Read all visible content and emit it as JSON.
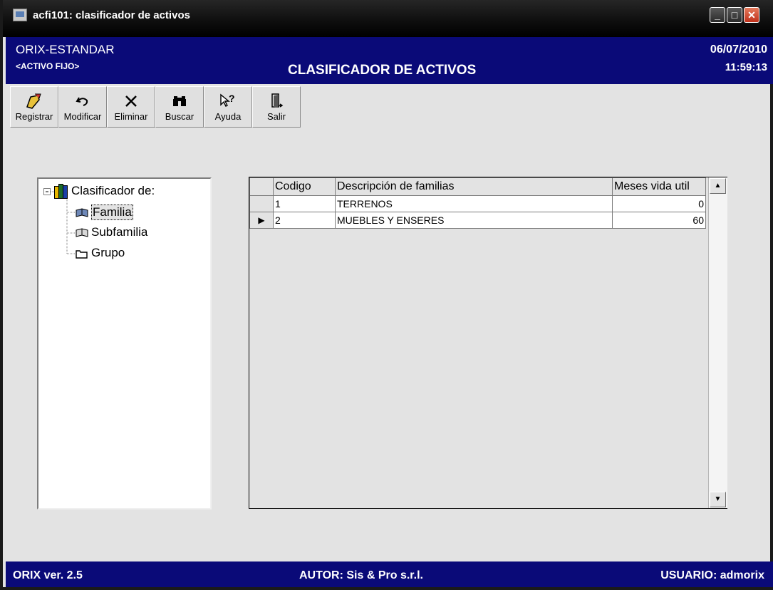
{
  "window": {
    "title": "acfi101: clasificador de activos"
  },
  "header": {
    "company": "ORIX-ESTANDAR",
    "module": "<ACTIVO FIJO>",
    "title": "CLASIFICADOR DE ACTIVOS",
    "date": "06/07/2010",
    "time": "11:59:13"
  },
  "toolbar": {
    "items": [
      {
        "label": "Registrar",
        "icon": "register-icon"
      },
      {
        "label": "Modificar",
        "icon": "undo-icon"
      },
      {
        "label": "Eliminar",
        "icon": "delete-x-icon"
      },
      {
        "label": "Buscar",
        "icon": "binoculars-icon"
      },
      {
        "label": "Ayuda",
        "icon": "help-cursor-icon"
      },
      {
        "label": "Salir",
        "icon": "exit-door-icon"
      }
    ]
  },
  "tree": {
    "root": "Clasificador de:",
    "children": [
      "Familia",
      "Subfamilia",
      "Grupo"
    ],
    "selected": "Familia"
  },
  "grid": {
    "columns": [
      "Codigo",
      "Descripción de familias",
      "Meses vida util"
    ],
    "rows": [
      {
        "codigo": "1",
        "descripcion": "TERRENOS",
        "meses": "0"
      },
      {
        "codigo": "2",
        "descripcion": "MUEBLES Y ENSERES",
        "meses": "60"
      }
    ],
    "current_row": 2
  },
  "status": {
    "version": "ORIX ver. 2.5",
    "author": "AUTOR: Sis & Pro s.r.l.",
    "user": "USUARIO: admorix"
  },
  "colors": {
    "header_bg": "#0a0a78",
    "window_bg": "#e3e3e3",
    "close_button": "#c0301a"
  }
}
